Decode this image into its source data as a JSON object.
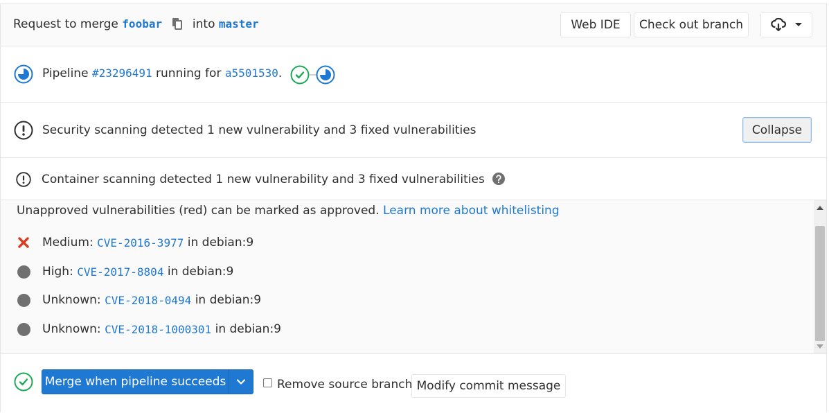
{
  "header": {
    "request_prefix": "Request to merge",
    "source_branch": "foobar",
    "into_text": "into",
    "target_branch": "master",
    "web_ide_label": "Web IDE",
    "checkout_label": "Check out branch"
  },
  "pipeline": {
    "prefix": "Pipeline",
    "id": "#23296491",
    "running_for": "running for",
    "commit": "a5501530",
    "period": "."
  },
  "security": {
    "summary": "Security scanning detected 1 new vulnerability and 3 fixed vulnerabilities",
    "collapse_label": "Collapse"
  },
  "container": {
    "summary": "Container scanning detected 1 new vulnerability and 3 fixed vulnerabilities"
  },
  "vulnerabilities": {
    "note": "Unapproved vulnerabilities (red) can be marked as approved.",
    "learn_more": "Learn more about whitelisting",
    "items": [
      {
        "severity": "Medium:",
        "cve": "CVE-2016-3977",
        "location": "in debian:9",
        "status": "unapproved"
      },
      {
        "severity": "High:",
        "cve": "CVE-2017-8804",
        "location": "in debian:9",
        "status": "approved"
      },
      {
        "severity": "Unknown:",
        "cve": "CVE-2018-0494",
        "location": "in debian:9",
        "status": "approved"
      },
      {
        "severity": "Unknown:",
        "cve": "CVE-2018-1000301",
        "location": "in debian:9",
        "status": "approved"
      }
    ]
  },
  "merge": {
    "primary_label": "Merge when pipeline succeeds",
    "remove_source_label": "Remove source branch",
    "modify_commit_label": "Modify commit message"
  },
  "colors": {
    "link": "#1f78d1",
    "success": "#1aaa55",
    "danger": "#db3b21",
    "running": "#1f78d1"
  }
}
